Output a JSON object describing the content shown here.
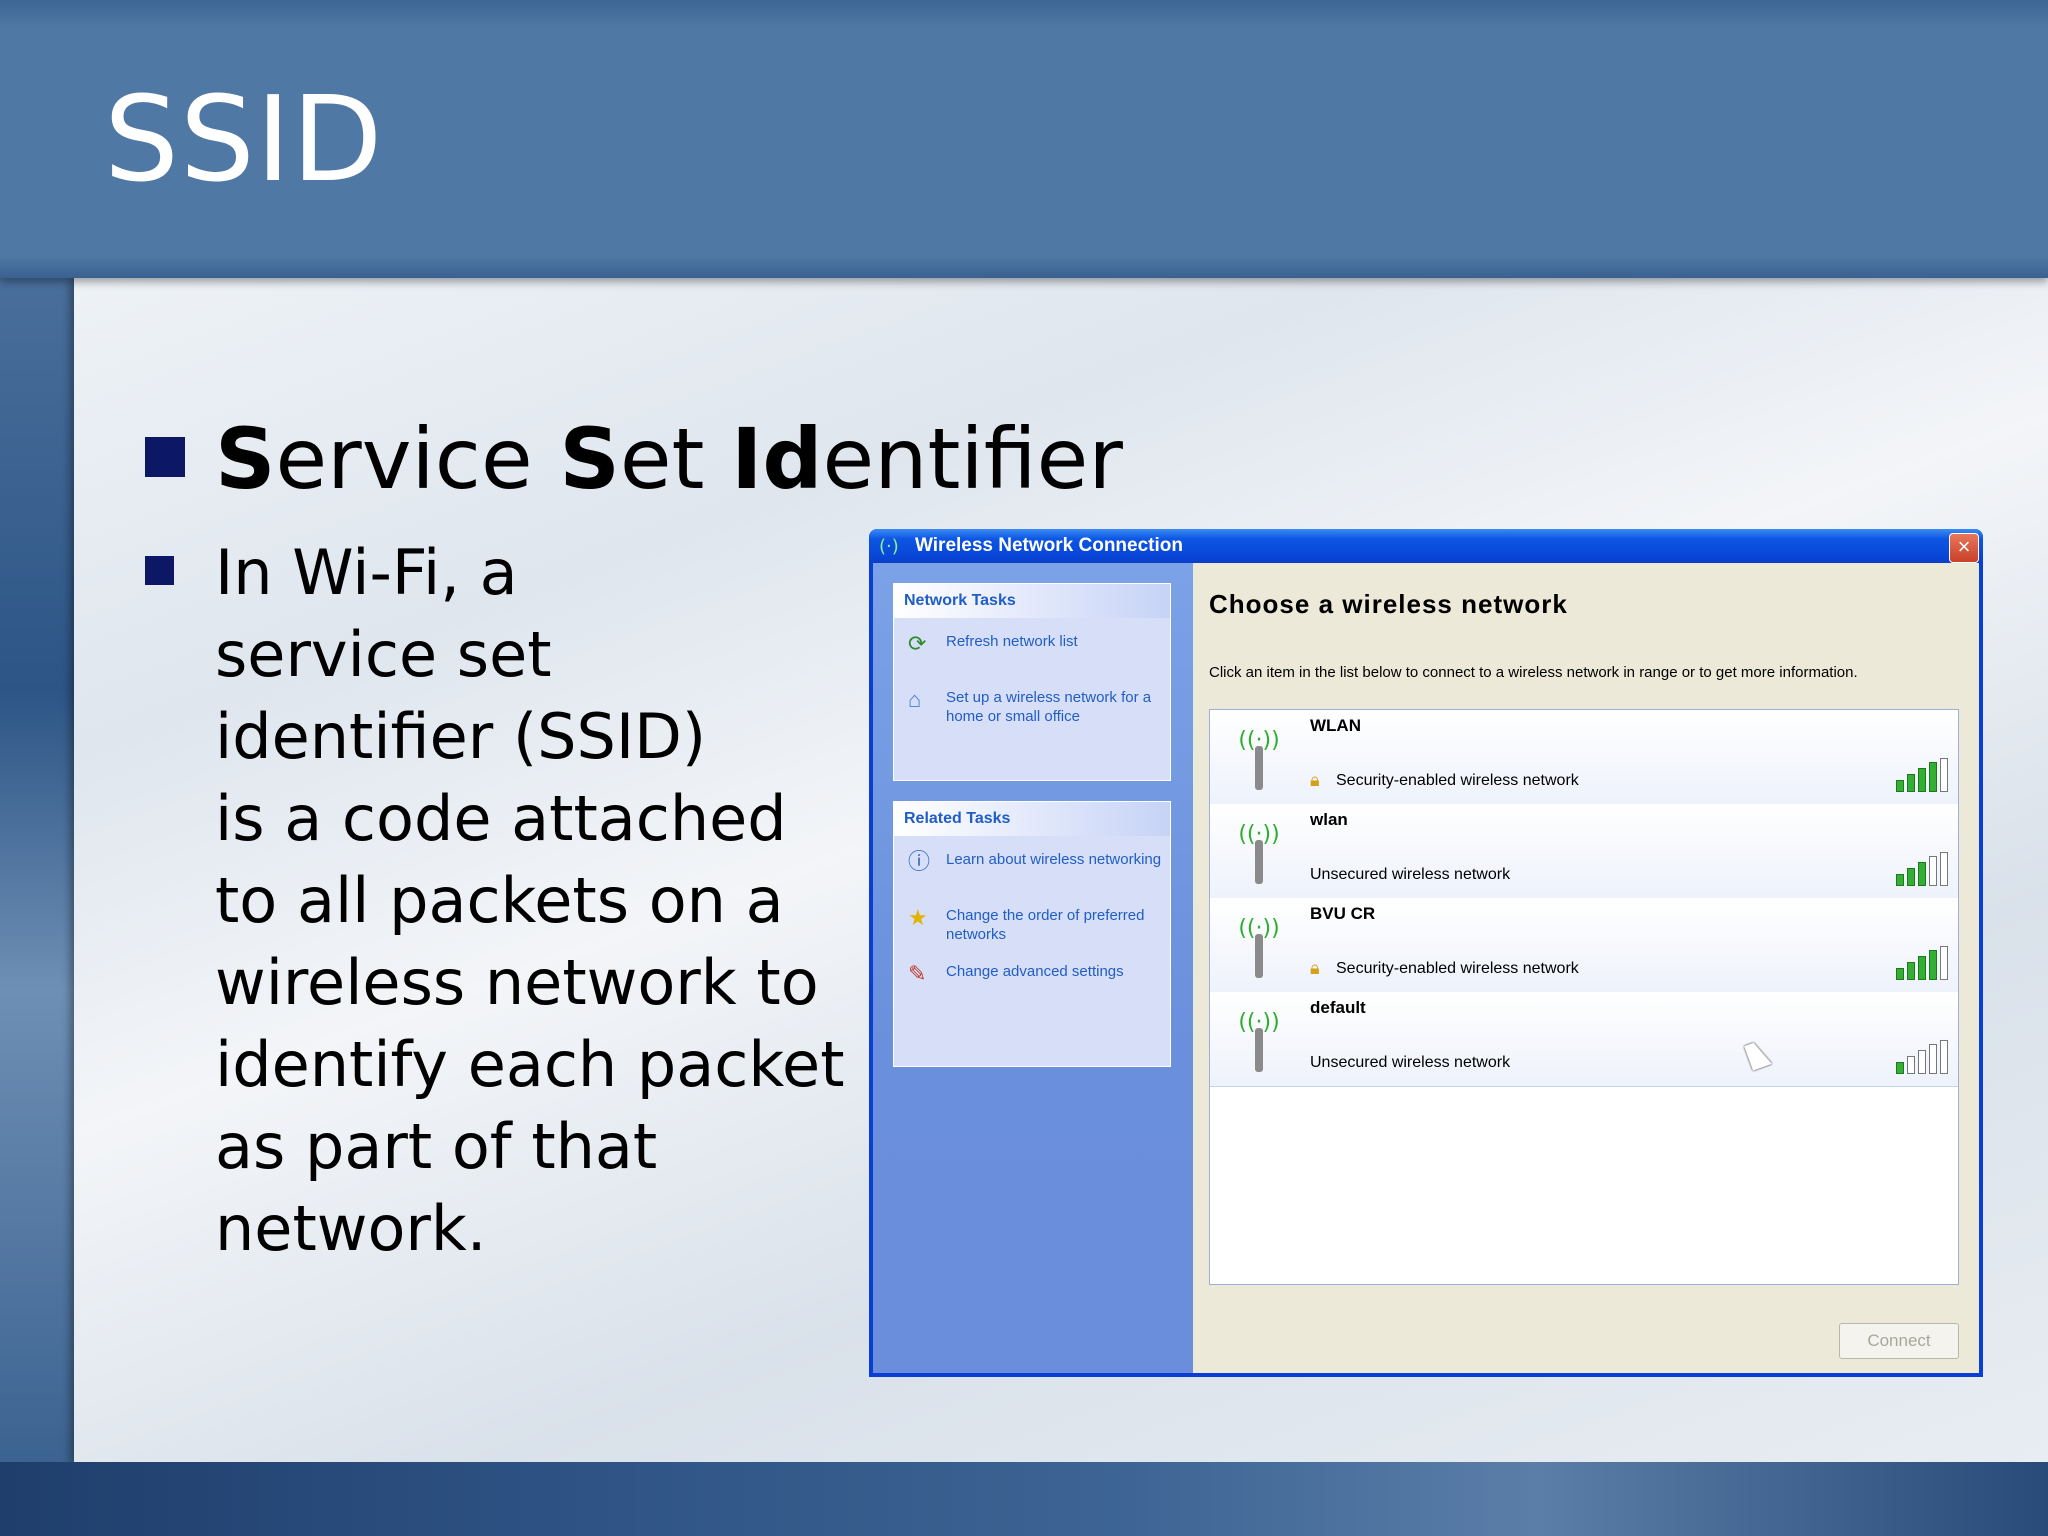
{
  "slide": {
    "title": "SSID",
    "heading_parts": [
      "S",
      "ervice ",
      "S",
      "et ",
      "Id",
      "entifier"
    ],
    "body_lines": [
      "In Wi-Fi, a",
      "service set",
      "identifier (SSID)",
      "is a code attached",
      "to all packets on a",
      "wireless network to",
      "identify each packet",
      "as part of that",
      "network."
    ]
  },
  "window": {
    "title": "Wireless Network Connection",
    "close_label": "×",
    "network_tasks": {
      "header": "Network Tasks",
      "items": [
        {
          "icon": "refresh-icon",
          "label": "Refresh network list"
        },
        {
          "icon": "setup-network-icon",
          "label": "Set up a wireless network for a home or small office"
        }
      ]
    },
    "related_tasks": {
      "header": "Related Tasks",
      "items": [
        {
          "icon": "info-icon",
          "label": "Learn about wireless networking"
        },
        {
          "icon": "star-icon",
          "label": "Change the order of preferred networks"
        },
        {
          "icon": "settings-icon",
          "label": "Change advanced settings"
        }
      ]
    },
    "main_title": "Choose a wireless network",
    "description": "Click an item in the list below to connect to a wireless network in range or to get more information.",
    "networks": [
      {
        "name": "WLAN",
        "status": "Security-enabled wireless network",
        "secured": true,
        "signal": 4
      },
      {
        "name": "wlan",
        "status": "Unsecured wireless network",
        "secured": false,
        "signal": 3
      },
      {
        "name": "BVU CR",
        "status": "Security-enabled wireless network",
        "secured": true,
        "signal": 4
      },
      {
        "name": "default",
        "status": "Unsecured wireless network",
        "secured": false,
        "signal": 1
      }
    ],
    "connect_label": "Connect"
  },
  "colors": {
    "title_bar": "#4f78a5",
    "bullet": "#0c1766",
    "xp_blue": "#0846d8",
    "task_link": "#215dc6",
    "signal_on": "#33b033"
  }
}
